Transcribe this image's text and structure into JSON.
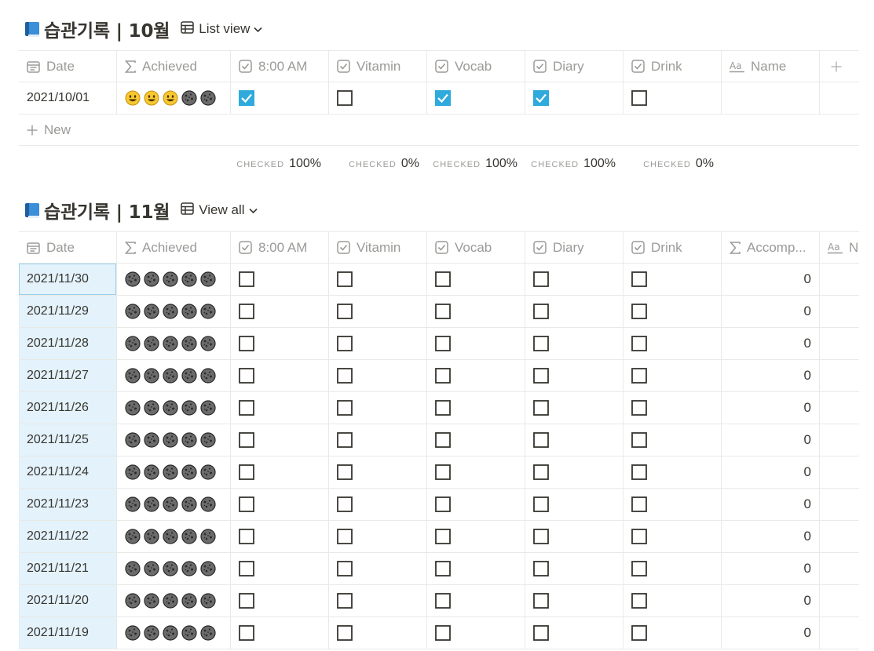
{
  "oct": {
    "title": "습관기록 | 10월",
    "view_label": "List view",
    "columns": [
      {
        "name": "Date",
        "icon": "calendar-icon"
      },
      {
        "name": "Achieved",
        "icon": "sigma-icon"
      },
      {
        "name": "8:00 AM",
        "icon": "checkbox-icon"
      },
      {
        "name": "Vitamin",
        "icon": "checkbox-icon"
      },
      {
        "name": "Vocab",
        "icon": "checkbox-icon"
      },
      {
        "name": "Diary",
        "icon": "checkbox-icon"
      },
      {
        "name": "Drink",
        "icon": "checkbox-icon"
      },
      {
        "name": "Name",
        "icon": "text-icon"
      }
    ],
    "rows": [
      {
        "date": "2021/10/01",
        "achieved": [
          1,
          1,
          1,
          0,
          0
        ],
        "checks": [
          true,
          false,
          true,
          true,
          false
        ],
        "name": ""
      }
    ],
    "new_label": "New",
    "calcs": [
      {
        "label": "CHECKED",
        "value": "100%"
      },
      {
        "label": "CHECKED",
        "value": "0%"
      },
      {
        "label": "CHECKED",
        "value": "100%"
      },
      {
        "label": "CHECKED",
        "value": "100%"
      },
      {
        "label": "CHECKED",
        "value": "0%"
      }
    ]
  },
  "nov": {
    "title": "습관기록 | 11월",
    "view_label": "View all",
    "columns": [
      {
        "name": "Date",
        "icon": "calendar-icon"
      },
      {
        "name": "Achieved",
        "icon": "sigma-icon"
      },
      {
        "name": "8:00 AM",
        "icon": "checkbox-icon"
      },
      {
        "name": "Vitamin",
        "icon": "checkbox-icon"
      },
      {
        "name": "Vocab",
        "icon": "checkbox-icon"
      },
      {
        "name": "Diary",
        "icon": "checkbox-icon"
      },
      {
        "name": "Drink",
        "icon": "checkbox-icon"
      },
      {
        "name": "Accomp...",
        "icon": "sigma-icon"
      },
      {
        "name": "Na",
        "icon": "text-icon"
      }
    ],
    "rows": [
      {
        "date": "2021/11/30",
        "achieved": [
          0,
          0,
          0,
          0,
          0
        ],
        "checks": [
          false,
          false,
          false,
          false,
          false
        ],
        "accomp": "0"
      },
      {
        "date": "2021/11/29",
        "achieved": [
          0,
          0,
          0,
          0,
          0
        ],
        "checks": [
          false,
          false,
          false,
          false,
          false
        ],
        "accomp": "0"
      },
      {
        "date": "2021/11/28",
        "achieved": [
          0,
          0,
          0,
          0,
          0
        ],
        "checks": [
          false,
          false,
          false,
          false,
          false
        ],
        "accomp": "0"
      },
      {
        "date": "2021/11/27",
        "achieved": [
          0,
          0,
          0,
          0,
          0
        ],
        "checks": [
          false,
          false,
          false,
          false,
          false
        ],
        "accomp": "0"
      },
      {
        "date": "2021/11/26",
        "achieved": [
          0,
          0,
          0,
          0,
          0
        ],
        "checks": [
          false,
          false,
          false,
          false,
          false
        ],
        "accomp": "0"
      },
      {
        "date": "2021/11/25",
        "achieved": [
          0,
          0,
          0,
          0,
          0
        ],
        "checks": [
          false,
          false,
          false,
          false,
          false
        ],
        "accomp": "0"
      },
      {
        "date": "2021/11/24",
        "achieved": [
          0,
          0,
          0,
          0,
          0
        ],
        "checks": [
          false,
          false,
          false,
          false,
          false
        ],
        "accomp": "0"
      },
      {
        "date": "2021/11/23",
        "achieved": [
          0,
          0,
          0,
          0,
          0
        ],
        "checks": [
          false,
          false,
          false,
          false,
          false
        ],
        "accomp": "0"
      },
      {
        "date": "2021/11/22",
        "achieved": [
          0,
          0,
          0,
          0,
          0
        ],
        "checks": [
          false,
          false,
          false,
          false,
          false
        ],
        "accomp": "0"
      },
      {
        "date": "2021/11/21",
        "achieved": [
          0,
          0,
          0,
          0,
          0
        ],
        "checks": [
          false,
          false,
          false,
          false,
          false
        ],
        "accomp": "0"
      },
      {
        "date": "2021/11/20",
        "achieved": [
          0,
          0,
          0,
          0,
          0
        ],
        "checks": [
          false,
          false,
          false,
          false,
          false
        ],
        "accomp": "0"
      },
      {
        "date": "2021/11/19",
        "achieved": [
          0,
          0,
          0,
          0,
          0
        ],
        "checks": [
          false,
          false,
          false,
          false,
          false
        ],
        "accomp": "0"
      }
    ]
  },
  "colors": {
    "checked": "#2eaadc",
    "border": "#e9e9e7",
    "muted": "#9b9a97",
    "selection": "#e3f2fb",
    "text": "#37352f"
  }
}
